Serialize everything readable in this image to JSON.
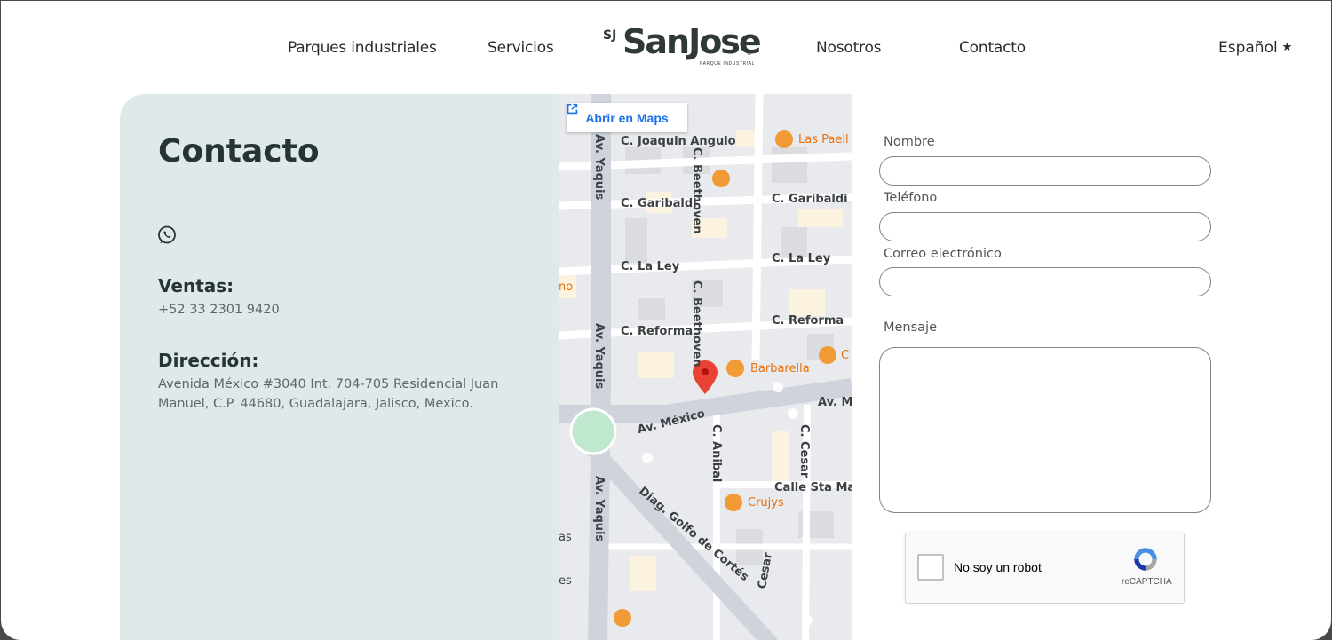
{
  "header": {
    "nav_left": [
      "Parques industriales",
      "Servicios"
    ],
    "nav_right": [
      "Nosotros",
      "Contacto"
    ],
    "logo": {
      "initials": "SJ",
      "name": "SanJose",
      "subtitle": "PARQUE INDUSTRIAL",
      "mark": "®"
    },
    "language": "Español",
    "language_icon": "star-icon"
  },
  "contact": {
    "title": "Contacto",
    "whatsapp_icon": "whatsapp-icon",
    "sales_label": "Ventas:",
    "sales_phone": "+52 33 2301 9420",
    "address_label": "Dirección:",
    "address_line1": "Avenida México #3040 Int. 704-705 Residencial Juan",
    "address_line2": "Manuel, C.P. 44680, Guadalajara, Jalisco, Mexico."
  },
  "map": {
    "open_button": "Abrir en Maps",
    "streets": {
      "joaquin": "C. Joaquin Angulo",
      "beethoven": "C. Beethoven",
      "garibaldi": "C. Garibaldi",
      "laley": "C. La Ley",
      "reforma": "C. Reforma",
      "yaquis": "Av. Yaquis",
      "mexico": "Av. México",
      "mexico_right": "Av. M",
      "anibal": "C. Anibal",
      "cesar": "C. Cesar",
      "sta_ma": "Calle Sta Ma",
      "golfo": "Diag. Golfo de Cortés",
      "cesar2": "Cesar",
      "partial_no": "no",
      "partial_as": "as",
      "partial_es": "es"
    },
    "places": {
      "las_paell": "Las Paell",
      "barbarella": "Barbarella",
      "crujys": "Crujys",
      "c_partial": "C"
    }
  },
  "form": {
    "name_label": "Nombre",
    "phone_label": "Teléfono",
    "email_label": "Correo electrónico",
    "message_label": "Mensaje",
    "captcha_text": "No soy un robot",
    "captcha_brand": "reCAPTCHA"
  },
  "colors": {
    "card_bg": "#dfe9ea",
    "title": "#263432",
    "maps_link": "#1a73e8",
    "poi": "#e8710a",
    "marker": "#ea4335"
  }
}
